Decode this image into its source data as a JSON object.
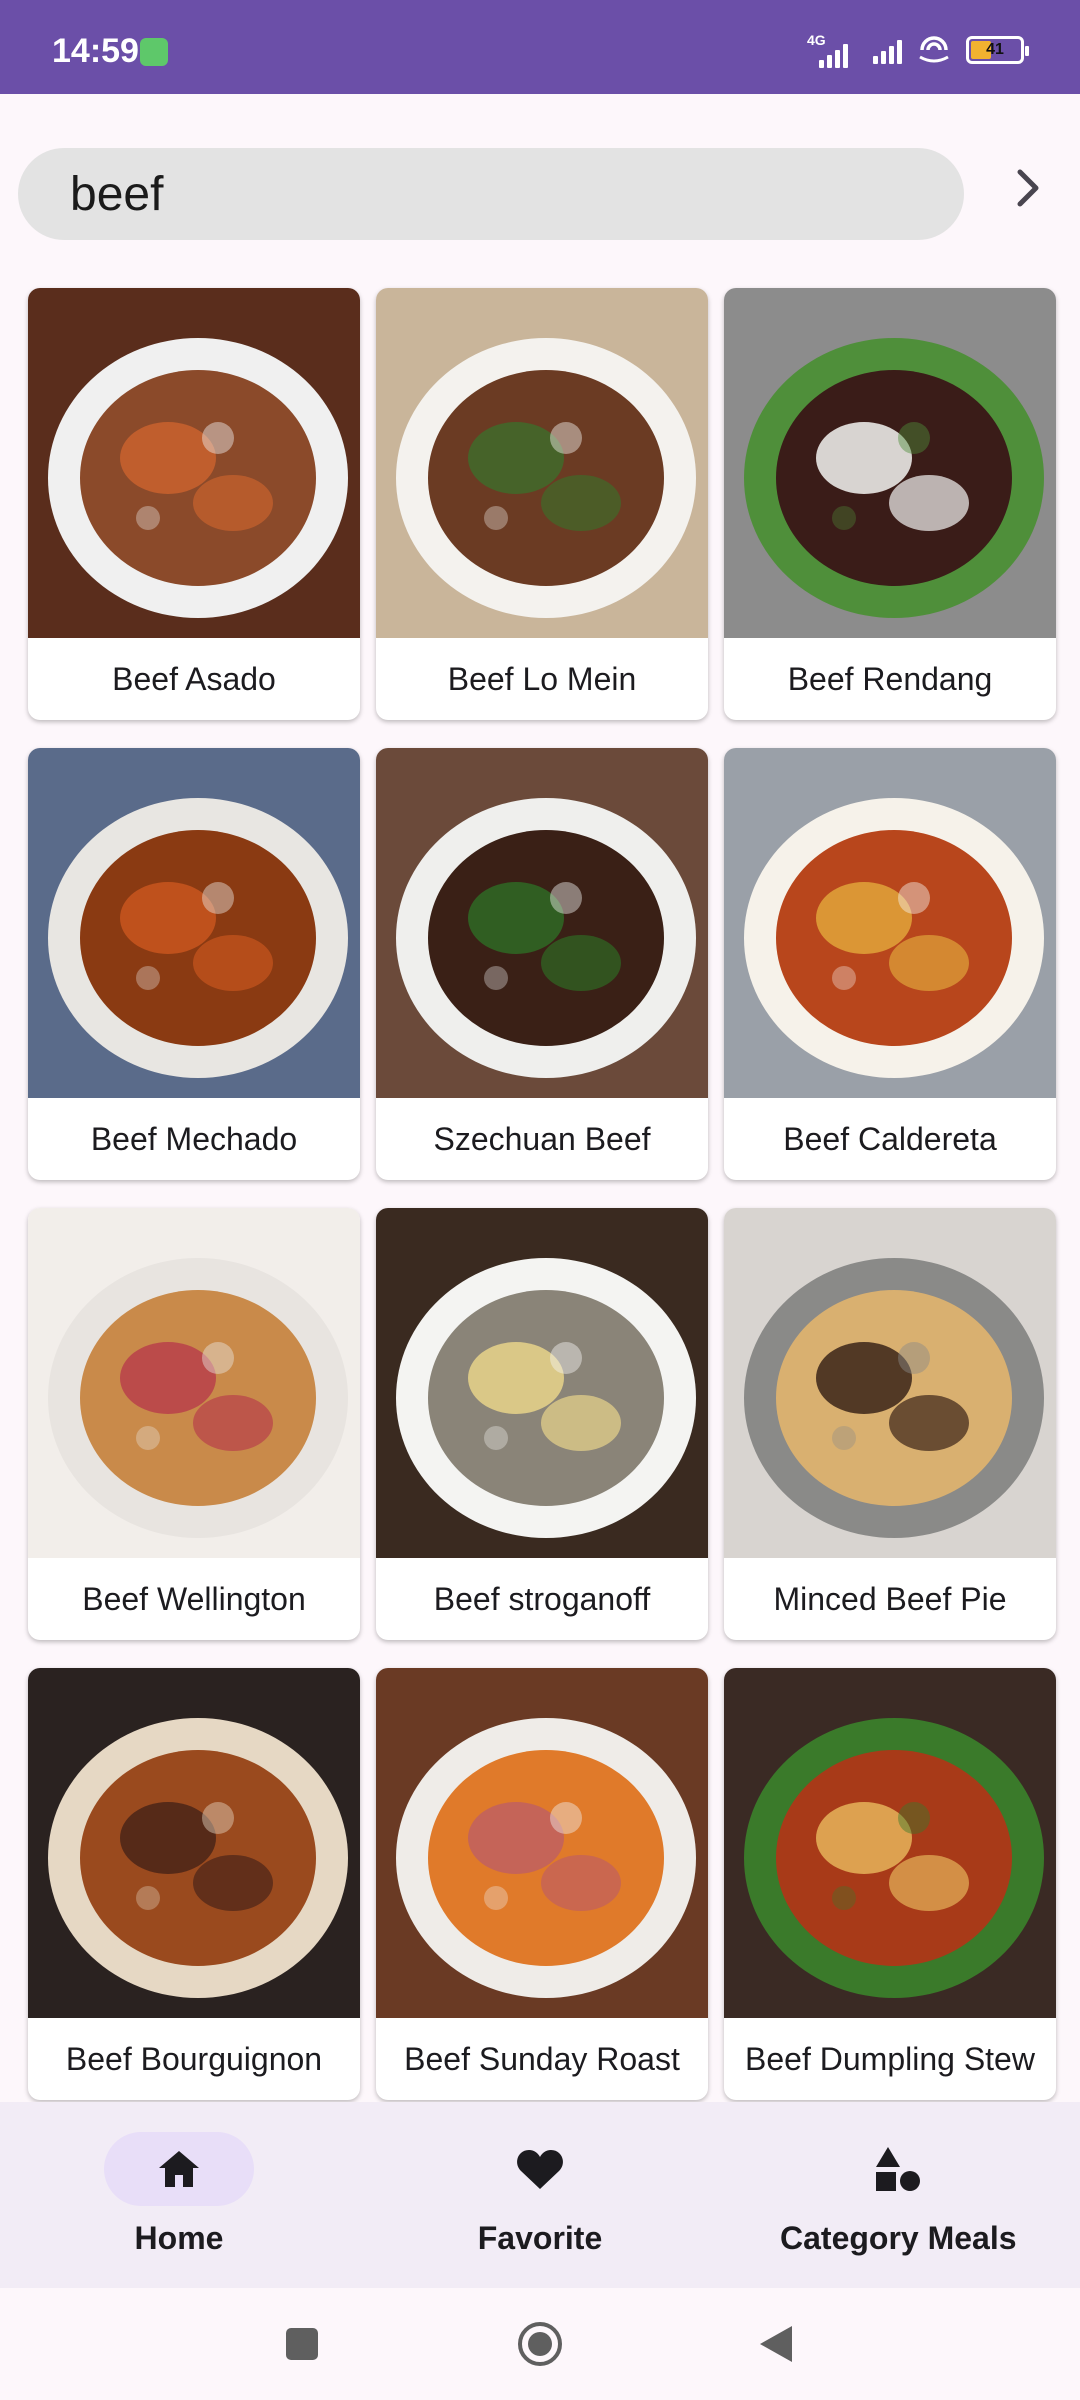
{
  "status_bar": {
    "time": "14:59",
    "network_tag": "4G",
    "battery_percent": "41",
    "battery_level": 0.41,
    "background": "#6b4fa8"
  },
  "search": {
    "value": "beef",
    "placeholder": "",
    "submit_icon": "chevron-right-icon"
  },
  "meals": [
    {
      "name": "Beef Asado",
      "palette": [
        "#5a2d1c",
        "#8b4a2a",
        "#c9622e",
        "#f0f0f0"
      ]
    },
    {
      "name": "Beef Lo Mein",
      "palette": [
        "#c9b59a",
        "#6b3b23",
        "#3f6b2a",
        "#f4f2ee"
      ]
    },
    {
      "name": "Beef Rendang",
      "palette": [
        "#8c8c8c",
        "#3a1c18",
        "#f4f4f2",
        "#4f8f3a"
      ]
    },
    {
      "name": "Beef Mechado",
      "palette": [
        "#5a6b8a",
        "#8a3a12",
        "#c8561e",
        "#e8e6e2"
      ]
    },
    {
      "name": "Szechuan Beef",
      "palette": [
        "#6b4a3a",
        "#3a2016",
        "#2f6a24",
        "#efefed"
      ]
    },
    {
      "name": "Beef Caldereta",
      "palette": [
        "#9aa0a8",
        "#b8461c",
        "#e0a43a",
        "#f6f2ea"
      ]
    },
    {
      "name": "Beef Wellington",
      "palette": [
        "#f2eeea",
        "#c98a4a",
        "#b8404a",
        "#e8e4e0"
      ]
    },
    {
      "name": "Beef stroganoff",
      "palette": [
        "#3a2a20",
        "#8a8478",
        "#e8d48a",
        "#f4f4f2"
      ]
    },
    {
      "name": "Minced Beef Pie",
      "palette": [
        "#d8d4d0",
        "#d9b070",
        "#3a2418",
        "#8a8a88"
      ]
    },
    {
      "name": "Beef Bourguignon",
      "palette": [
        "#2a2220",
        "#9a4a1e",
        "#4a2418",
        "#e6d8c4"
      ]
    },
    {
      "name": "Beef Sunday Roast",
      "palette": [
        "#6a3a24",
        "#e07a2a",
        "#c06060",
        "#efece8"
      ]
    },
    {
      "name": "Beef Dumpling Stew",
      "palette": [
        "#3a2a24",
        "#a83a18",
        "#e6b45a",
        "#3a7a2a"
      ]
    }
  ],
  "bottom_nav": {
    "items": [
      {
        "label": "Home",
        "icon": "home-icon",
        "active": true
      },
      {
        "label": "Favorite",
        "icon": "heart-icon",
        "active": false
      },
      {
        "label": "Category Meals",
        "icon": "shapes-icon",
        "active": false
      }
    ]
  },
  "system_nav": {
    "buttons": [
      "recents-icon",
      "home-circle-icon",
      "back-icon"
    ]
  }
}
